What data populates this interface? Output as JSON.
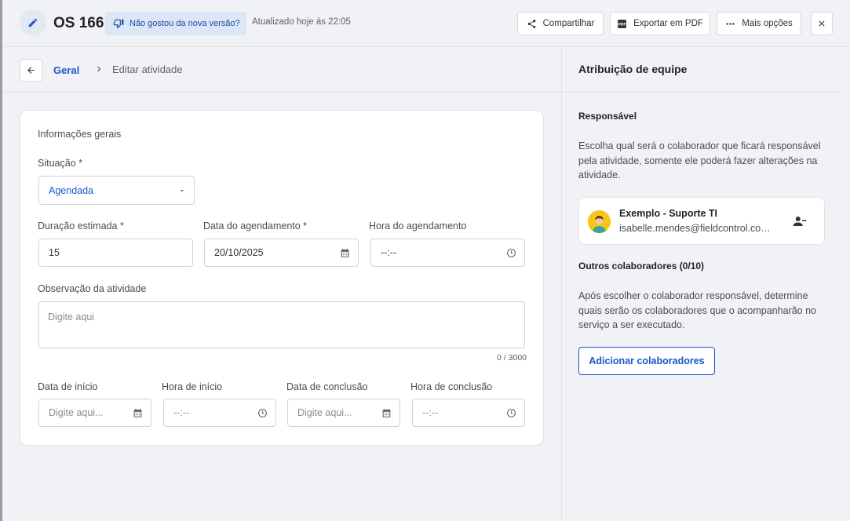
{
  "header": {
    "title": "OS 166",
    "feedback_label": "Não gostou da nova versão?",
    "updated_text": "Atualizado hoje às 22:05",
    "share_label": "Compartilhar",
    "export_label": "Exportar em PDF",
    "more_label": "Mais opções"
  },
  "breadcrumb": {
    "active": "Geral",
    "current": "Editar atividade"
  },
  "form": {
    "section_title": "Informações gerais",
    "status_label": "Situação *",
    "status_value": "Agendada",
    "duration_label": "Duração estimada *",
    "duration_value": "15",
    "schedule_date_label": "Data do agendamento *",
    "schedule_date_value": "20/10/2025",
    "schedule_time_label": "Hora do agendamento",
    "schedule_time_value": "--:--",
    "notes_label": "Observação da atividade",
    "notes_placeholder": "Digite aqui",
    "notes_counter": "0 / 3000",
    "start_date_label": "Data de início",
    "start_date_placeholder": "Digite aqui...",
    "start_time_label": "Hora de início",
    "start_time_value": "--:--",
    "end_date_label": "Data de conclusão",
    "end_date_placeholder": "Digite aqui...",
    "end_time_label": "Hora de conclusão",
    "end_time_value": "--:--"
  },
  "team": {
    "title": "Atribuição de equipe",
    "responsible_heading": "Responsável",
    "responsible_desc": "Escolha qual será o colaborador que ficará responsável pela atividade, somente ele poderá fazer alterações na atividade.",
    "responsible_name": "Exemplo - Suporte TI",
    "responsible_email": "isabelle.mendes@fieldcontrol.com.br",
    "others_heading": "Outros colaboradores (0/10)",
    "others_desc": "Após escolher o colaborador responsável, determine quais serão os colaboradores que o acompanharão no serviço a ser executado.",
    "add_label": "Adicionar colaboradores"
  },
  "colors": {
    "accent": "#1a56c9",
    "background": "#f1f2f6"
  }
}
